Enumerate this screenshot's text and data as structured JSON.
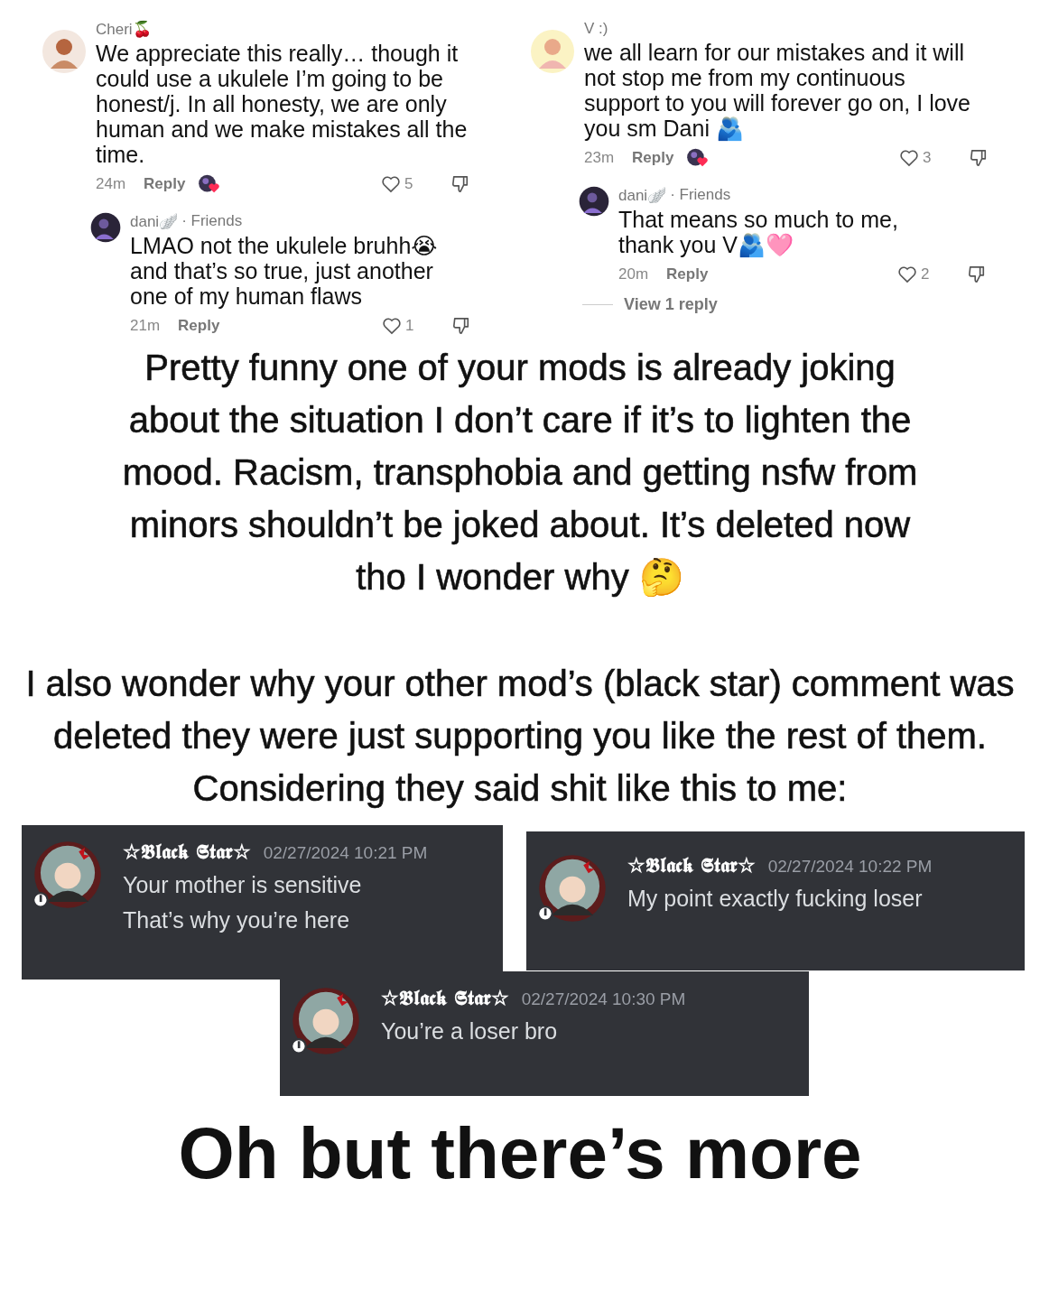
{
  "comment_threads": [
    {
      "author": "Cheri🍒",
      "text": "We appreciate this really… though it could use a ukulele I’m going to be honest/j. In all honesty, we are only human and we make mistakes all the time.",
      "time": "24m",
      "reply_label": "Reply",
      "creator_liked": true,
      "likes": "5",
      "replies": [
        {
          "author": "dani🪽",
          "badge": "· Friends",
          "text": "LMAO not the ukulele bruhh😭 and that’s so true, just another one of my human flaws",
          "time": "21m",
          "reply_label": "Reply",
          "creator_liked": false,
          "likes": "1"
        }
      ]
    },
    {
      "author": "V :)",
      "text": "we all learn for our mistakes and it will not stop me from my continuous support to you will forever go on, I love you sm Dani 🫂",
      "time": "23m",
      "reply_label": "Reply",
      "creator_liked": true,
      "likes": "3",
      "replies": [
        {
          "author": "dani🪽",
          "badge": "· Friends",
          "text": "That means so much to me, thank you V🫂🩷",
          "time": "20m",
          "reply_label": "Reply",
          "creator_liked": false,
          "likes": "2"
        }
      ],
      "view_replies": "View 1 reply"
    }
  ],
  "paragraphs": [
    "Pretty funny one of your mods is already joking about the situation I don’t care if it’s to lighten the mood. Racism, transphobia and getting nsfw from minors shouldn’t be joked about. It’s deleted now tho I wonder why 🤔",
    "I also wonder why your other mod’s (black star) comment was deleted they were just supporting you like the rest of them. Considering they said shit like this to me:"
  ],
  "discord_messages": [
    {
      "author": "☆𝕭𝖑𝖆𝖈𝖐 𝕾𝖙𝖆𝖗☆",
      "timestamp": "02/27/2024 10:21 PM",
      "lines": [
        "Your mother is sensitive",
        "That’s why you’re here"
      ]
    },
    {
      "author": "☆𝕭𝖑𝖆𝖈𝖐 𝕾𝖙𝖆𝖗☆",
      "timestamp": "02/27/2024 10:22 PM",
      "lines": [
        "My point exactly fucking loser"
      ]
    },
    {
      "author": "☆𝕭𝖑𝖆𝖈𝖐 𝕾𝖙𝖆𝖗☆",
      "timestamp": "02/27/2024 10:30 PM",
      "lines": [
        "You’re a loser bro"
      ]
    }
  ],
  "closing_heading": "Oh but there’s more"
}
